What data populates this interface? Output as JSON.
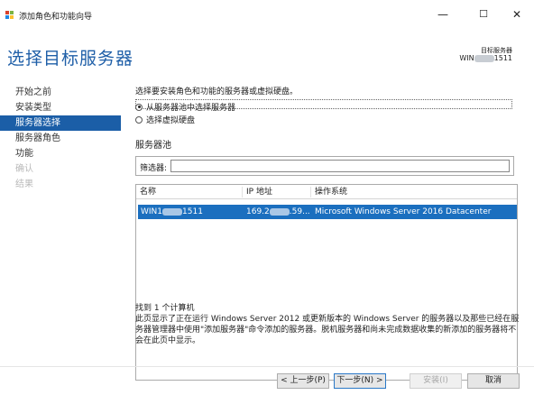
{
  "window": {
    "title": "添加角色和功能向导",
    "minimize": "—",
    "maximize": "☐",
    "close": "✕"
  },
  "page": {
    "title": "选择目标服务器"
  },
  "destination": {
    "label": "目标服务器",
    "name_prefix": "WIN",
    "name_suffix": "1511"
  },
  "sidebar": {
    "items": [
      {
        "label": "开始之前"
      },
      {
        "label": "安装类型"
      },
      {
        "label": "服务器选择"
      },
      {
        "label": "服务器角色"
      },
      {
        "label": "功能"
      },
      {
        "label": "确认"
      },
      {
        "label": "结果"
      }
    ]
  },
  "content": {
    "instruction": "选择要安装角色和功能的服务器或虚拟硬盘。",
    "radio_pool": "从服务器池中选择服务器",
    "radio_vhd": "选择虚拟硬盘",
    "pool_section": "服务器池",
    "filter_label": "筛选器:",
    "filter_value": "",
    "columns": {
      "name": "名称",
      "ip": "IP 地址",
      "os": "操作系统"
    },
    "row": {
      "name_prefix": "WIN1",
      "name_suffix": "1511",
      "ip_prefix": "169.2",
      "ip_suffix": ".59...",
      "os": "Microsoft Windows Server 2016 Datacenter"
    },
    "found": "找到 1 个计算机",
    "description": "此页显示了正在运行 Windows Server 2012 或更新版本的 Windows Server 的服务器以及那些已经在服务器管理器中使用\"添加服务器\"命令添加的服务器。脱机服务器和尚未完成数据收集的新添加的服务器将不会在此页中显示。"
  },
  "buttons": {
    "prev": "< 上一步(P)",
    "next": "下一步(N) >",
    "install": "安装(I)",
    "cancel": "取消"
  },
  "colors": {
    "accent": "#1b5ea7",
    "title": "#1f5fa8",
    "selection": "#1b6fbf"
  }
}
